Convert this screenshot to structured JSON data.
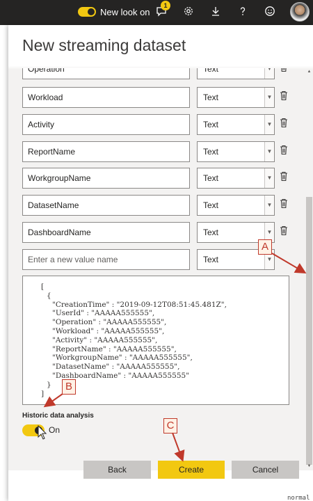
{
  "topbar": {
    "new_look_label": "New look on",
    "notification_count": "1",
    "icons": [
      "notification-icon",
      "gear-icon",
      "download-icon",
      "help-icon",
      "smiley-icon"
    ]
  },
  "dialog": {
    "title": "New streaming dataset"
  },
  "fields": [
    {
      "name": "Operation",
      "type": "Text"
    },
    {
      "name": "Workload",
      "type": "Text"
    },
    {
      "name": "Activity",
      "type": "Text"
    },
    {
      "name": "ReportName",
      "type": "Text"
    },
    {
      "name": "WorkgroupName",
      "type": "Text"
    },
    {
      "name": "DatasetName",
      "type": "Text"
    },
    {
      "name": "DashboardName",
      "type": "Text"
    }
  ],
  "new_field": {
    "placeholder": "Enter a new value name",
    "type": "Text"
  },
  "json_preview": [
    "[",
    "{",
    "\"CreationTime\" : \"2019-09-12T08:51:45.481Z\",",
    "\"UserId\" : \"AAAAA555555\",",
    "\"Operation\" : \"AAAAA555555\",",
    "\"Workload\" : \"AAAAA555555\",",
    "\"Activity\" : \"AAAAA555555\",",
    "\"ReportName\" : \"AAAAA555555\",",
    "\"WorkgroupName\" : \"AAAAA555555\",",
    "\"DatasetName\" : \"AAAAA555555\",",
    "\"DashboardName\" : \"AAAAA555555\"",
    "}",
    "]"
  ],
  "historic": {
    "label": "Historic data analysis",
    "state": "On"
  },
  "buttons": {
    "back": "Back",
    "create": "Create",
    "cancel": "Cancel"
  },
  "callouts": {
    "a": "A",
    "b": "B",
    "c": "C"
  },
  "corner_text": "normal",
  "colors": {
    "accent": "#f2c811",
    "topbar": "#252423",
    "callout_red": "#c0392b",
    "panel": "#f3f2f1"
  }
}
